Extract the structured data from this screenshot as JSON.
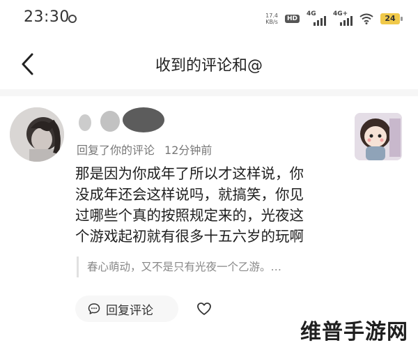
{
  "status": {
    "time": "23:30",
    "net_speed_value": "17.4",
    "net_speed_unit": "KB/s",
    "hd_badge": "HD",
    "signal1_label": "4G",
    "signal2_label": "4G+",
    "battery": "24",
    "battery_color": "#f0c94a"
  },
  "header": {
    "title": "收到的评论和@",
    "back_icon": "chevron-left-icon"
  },
  "comment": {
    "meta_action": "回复了你的评论",
    "meta_time": "12分钟前",
    "body_lines": [
      "那是因为你成年了所以才这样说，你",
      "没成年还会这样说吗，就搞笑，你见",
      "过哪些个真的按照规定来的，光夜这",
      "个游戏起初就有很多十五六岁的玩啊"
    ],
    "quoted": "春心萌动，又不是只有光夜一个乙游。…"
  },
  "actions": {
    "reply_label": "回复评论",
    "reply_icon": "comment-icon",
    "like_icon": "heart-icon"
  },
  "watermark": "维普手游网"
}
